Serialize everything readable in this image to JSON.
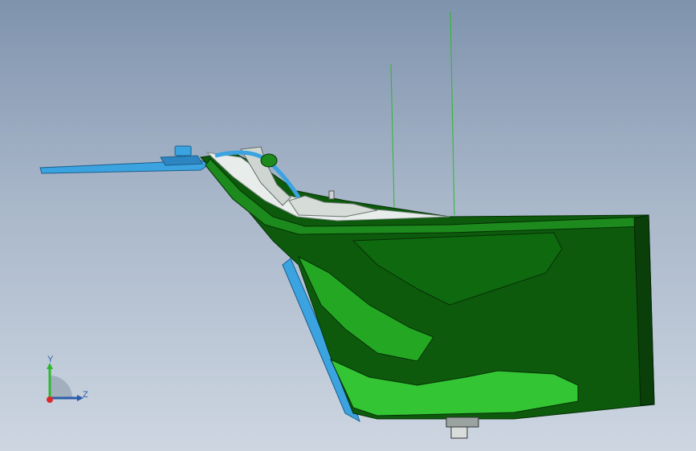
{
  "triad": {
    "y_label": "Y",
    "z_label": "Z"
  },
  "colors": {
    "background_top": "#7f93ad",
    "background_bottom": "#cdd6e1",
    "part_green": "#1c8a1c",
    "part_dark_green": "#0b4d0b",
    "part_light_green": "#34c534",
    "bracket_blue": "#3aa3e0",
    "inner_white": "#e8ecea",
    "axis_green": "#2db82d",
    "axis_blue": "#2c5ea8",
    "axis_red": "#d92b2b"
  }
}
